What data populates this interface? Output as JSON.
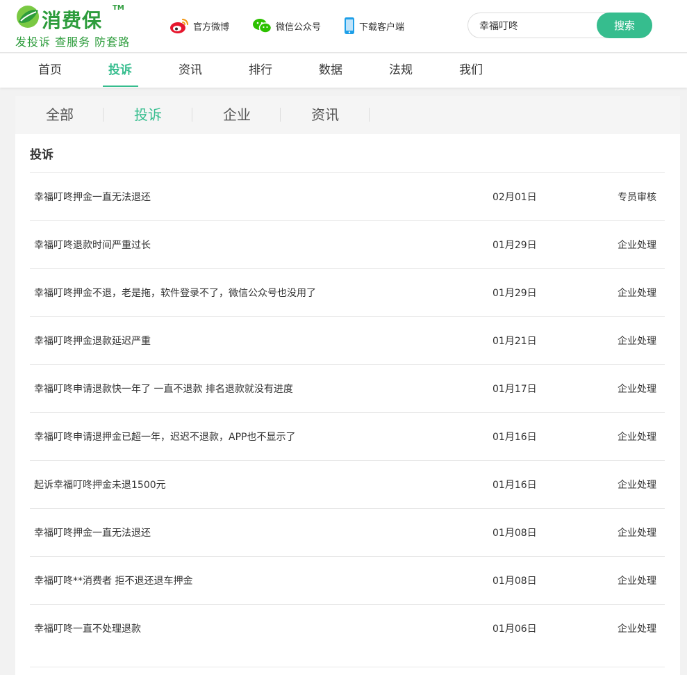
{
  "brand": {
    "name": "消费保",
    "tm": "TM",
    "slogan": "发投诉 查服务 防套路",
    "color": "#2d9c3c"
  },
  "header_links": [
    {
      "label": "官方微博",
      "icon": "weibo-icon"
    },
    {
      "label": "微信公众号",
      "icon": "wechat-icon"
    },
    {
      "label": "下载客户端",
      "icon": "mobile-phone-icon"
    }
  ],
  "search": {
    "value": "幸福叮咚",
    "button_label": "搜索"
  },
  "nav": {
    "items": [
      "首页",
      "投诉",
      "资讯",
      "排行",
      "数据",
      "法规",
      "我们"
    ],
    "active": "投诉"
  },
  "subtabs": {
    "items": [
      "全部",
      "投诉",
      "企业",
      "资讯"
    ],
    "active": "投诉"
  },
  "section_title": "投诉",
  "complaints": [
    {
      "title": "幸福叮咚押金一直无法退还",
      "date": "02月01日",
      "status": "专员审核"
    },
    {
      "title": "幸福叮咚退款时间严重过长",
      "date": "01月29日",
      "status": "企业处理"
    },
    {
      "title": "幸福叮咚押金不退，老是拖，软件登录不了，微信公众号也没用了",
      "date": "01月29日",
      "status": "企业处理"
    },
    {
      "title": "幸福叮咚押金退款延迟严重",
      "date": "01月21日",
      "status": "企业处理"
    },
    {
      "title": "幸福叮咚申请退款快一年了 一直不退款 排名退款就没有进度",
      "date": "01月17日",
      "status": "企业处理"
    },
    {
      "title": "幸福叮咚申请退押金已超一年，迟迟不退款，APP也不显示了",
      "date": "01月16日",
      "status": "企业处理"
    },
    {
      "title": "起诉幸福叮咚押金未退1500元",
      "date": "01月16日",
      "status": "企业处理"
    },
    {
      "title": "幸福叮咚押金一直无法退还",
      "date": "01月08日",
      "status": "企业处理"
    },
    {
      "title": "幸福叮咚**消费者 拒不退还退车押金",
      "date": "01月08日",
      "status": "企业处理"
    },
    {
      "title": "幸福叮咚一直不处理退款",
      "date": "01月06日",
      "status": "企业处理"
    }
  ],
  "colors": {
    "accent": "#36bd8e",
    "brand_green": "#2d9c3c",
    "weibo_red": "#e6162d",
    "wechat_green": "#2dc100",
    "phone_blue": "#1e9fe8"
  }
}
